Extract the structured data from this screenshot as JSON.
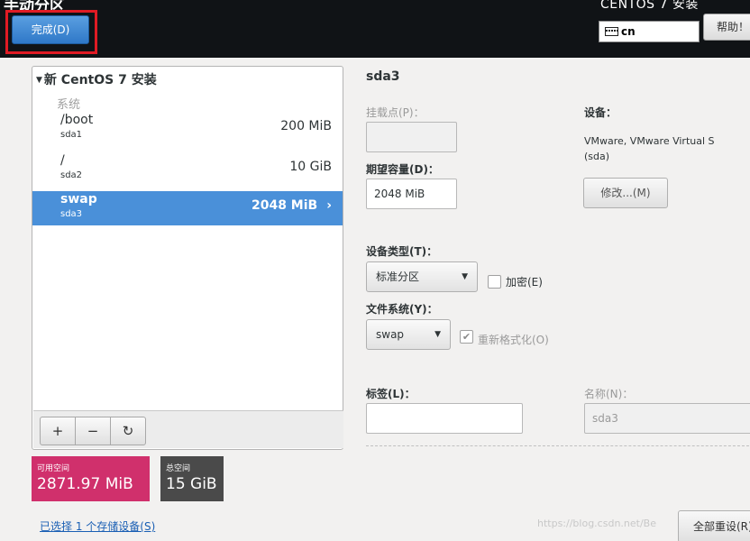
{
  "header": {
    "title": "手动分区",
    "done_label": "完成(D)",
    "product": "CENTOS 7 安装",
    "keyboard_layout": "cn",
    "help_label": "帮助！"
  },
  "tree": {
    "title": "新 CentOS 7 安装",
    "group_label": "系统",
    "partitions": [
      {
        "name": "/boot",
        "device": "sda1",
        "size": "200 MiB"
      },
      {
        "name": "/",
        "device": "sda2",
        "size": "10 GiB"
      },
      {
        "name": "swap",
        "device": "sda3",
        "size": "2048 MiB"
      }
    ],
    "toolbar": {
      "add": "+",
      "remove": "−",
      "refresh": "C"
    }
  },
  "space": {
    "available_label": "可用空间",
    "available_value": "2871.97 MiB",
    "total_label": "总空间",
    "total_value": "15 GiB"
  },
  "storage_link": "已选择 1 个存储设备(S)",
  "detail": {
    "title": "sda3",
    "mount_label": "挂载点(P)：",
    "mount_value": "",
    "capacity_label": "期望容量(D)：",
    "capacity_value": "2048 MiB",
    "device_label": "设备：",
    "device_line1": "VMware, VMware Virtual S",
    "device_line2": "(sda)",
    "modify_label": "修改...(M)",
    "device_type_label": "设备类型(T)：",
    "device_type_value": "标准分区",
    "encrypt_label": "加密(E)",
    "filesystem_label": "文件系统(Y)：",
    "filesystem_value": "swap",
    "reformat_label": "重新格式化(O)",
    "tag_label": "标签(L)：",
    "tag_value": "",
    "name_label": "名称(N)：",
    "name_value": "sda3"
  },
  "reset_label": "全部重设(R)",
  "watermark": "https://blog.csdn.net/Be"
}
